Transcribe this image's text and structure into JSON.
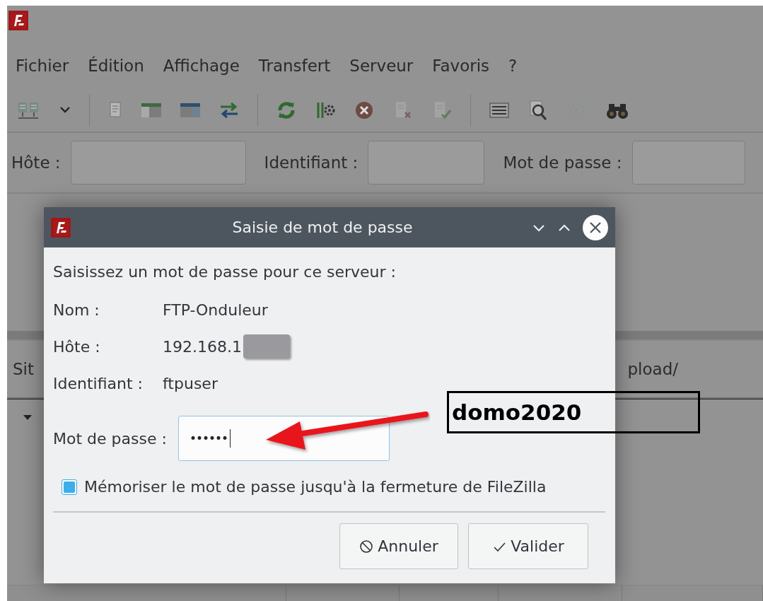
{
  "menu": [
    "Fichier",
    "Édition",
    "Affichage",
    "Transfert",
    "Serveur",
    "Favoris",
    "?"
  ],
  "toolbar": [
    {
      "kind": "server"
    },
    {
      "kind": "caret"
    },
    {
      "kind": "separator"
    },
    {
      "kind": "log"
    },
    {
      "kind": "left-panel"
    },
    {
      "kind": "right-panel"
    },
    {
      "kind": "transfer"
    },
    {
      "kind": "separator"
    },
    {
      "kind": "refresh"
    },
    {
      "kind": "filter-gear"
    },
    {
      "kind": "cancel"
    },
    {
      "kind": "doc-x"
    },
    {
      "kind": "doc-check"
    },
    {
      "kind": "separator"
    },
    {
      "kind": "list"
    },
    {
      "kind": "search"
    },
    {
      "kind": "gear"
    },
    {
      "kind": "binoculars"
    }
  ],
  "quickconnect": [
    {
      "label": "Hôte :"
    },
    {
      "label": "Identifiant :"
    },
    {
      "label": "Mot de passe :"
    }
  ],
  "site_panel": {
    "column_1": "Sit",
    "column_2": "pload/",
    "tree_expanded": true
  },
  "dialog": {
    "title": "Saisie de mot de passe",
    "prompt": "Saisissez un mot de passe pour ce serveur :",
    "fields": [
      {
        "label": "Nom :",
        "value": "FTP-Onduleur",
        "redacted": false
      },
      {
        "label": "Hôte :",
        "value": "192.168.1",
        "redacted": true
      },
      {
        "label": "Identifiant :",
        "value": "ftpuser",
        "redacted": false
      }
    ],
    "password": {
      "label": "Mot de passe :",
      "value": "••••••"
    },
    "remember": {
      "label": "Mémoriser le mot de passe jusqu'à la fermeture de FileZilla",
      "checked": true
    },
    "buttons": [
      {
        "label": "Annuler",
        "kind": "cancel"
      },
      {
        "label": "Valider",
        "kind": "ok"
      }
    ]
  },
  "annotation": {
    "text": "domo2020"
  }
}
